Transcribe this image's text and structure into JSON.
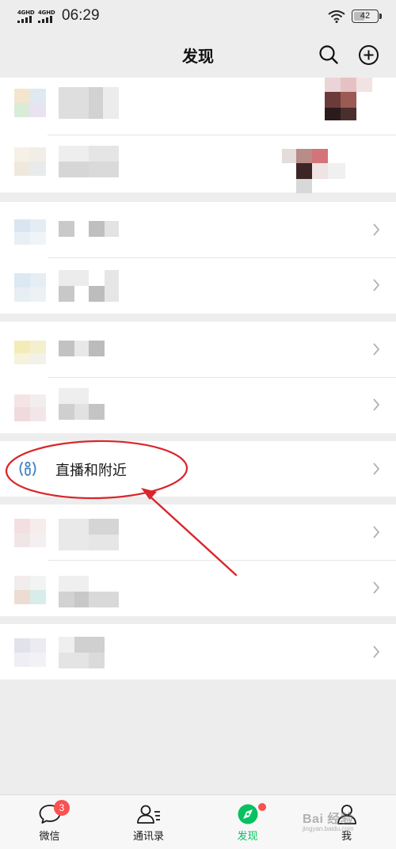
{
  "status_bar": {
    "net1": "4GHD",
    "net2": "4GHD",
    "time": "06:29",
    "battery": "42"
  },
  "header": {
    "title": "发现",
    "search_icon": "search-icon",
    "add_icon": "plus-circle-icon"
  },
  "list": {
    "live_nearby_label": "直播和附近",
    "live_nearby_icon": "live-nearby-icon",
    "chevron_icon": "chevron-right-icon"
  },
  "colors": {
    "accent_green": "#07c160",
    "badge_red": "#fa5151",
    "annotation_red": "#d9262c"
  },
  "tabbar": {
    "tabs": [
      {
        "label": "微信",
        "icon": "chat-bubble-icon",
        "badge": "3"
      },
      {
        "label": "通讯录",
        "icon": "contacts-icon"
      },
      {
        "label": "发现",
        "icon": "compass-icon",
        "active": true
      },
      {
        "label": "我",
        "icon": "person-icon"
      }
    ]
  },
  "watermark": {
    "text": "Bai 经验",
    "sub": "jingyan.baidu.com"
  }
}
